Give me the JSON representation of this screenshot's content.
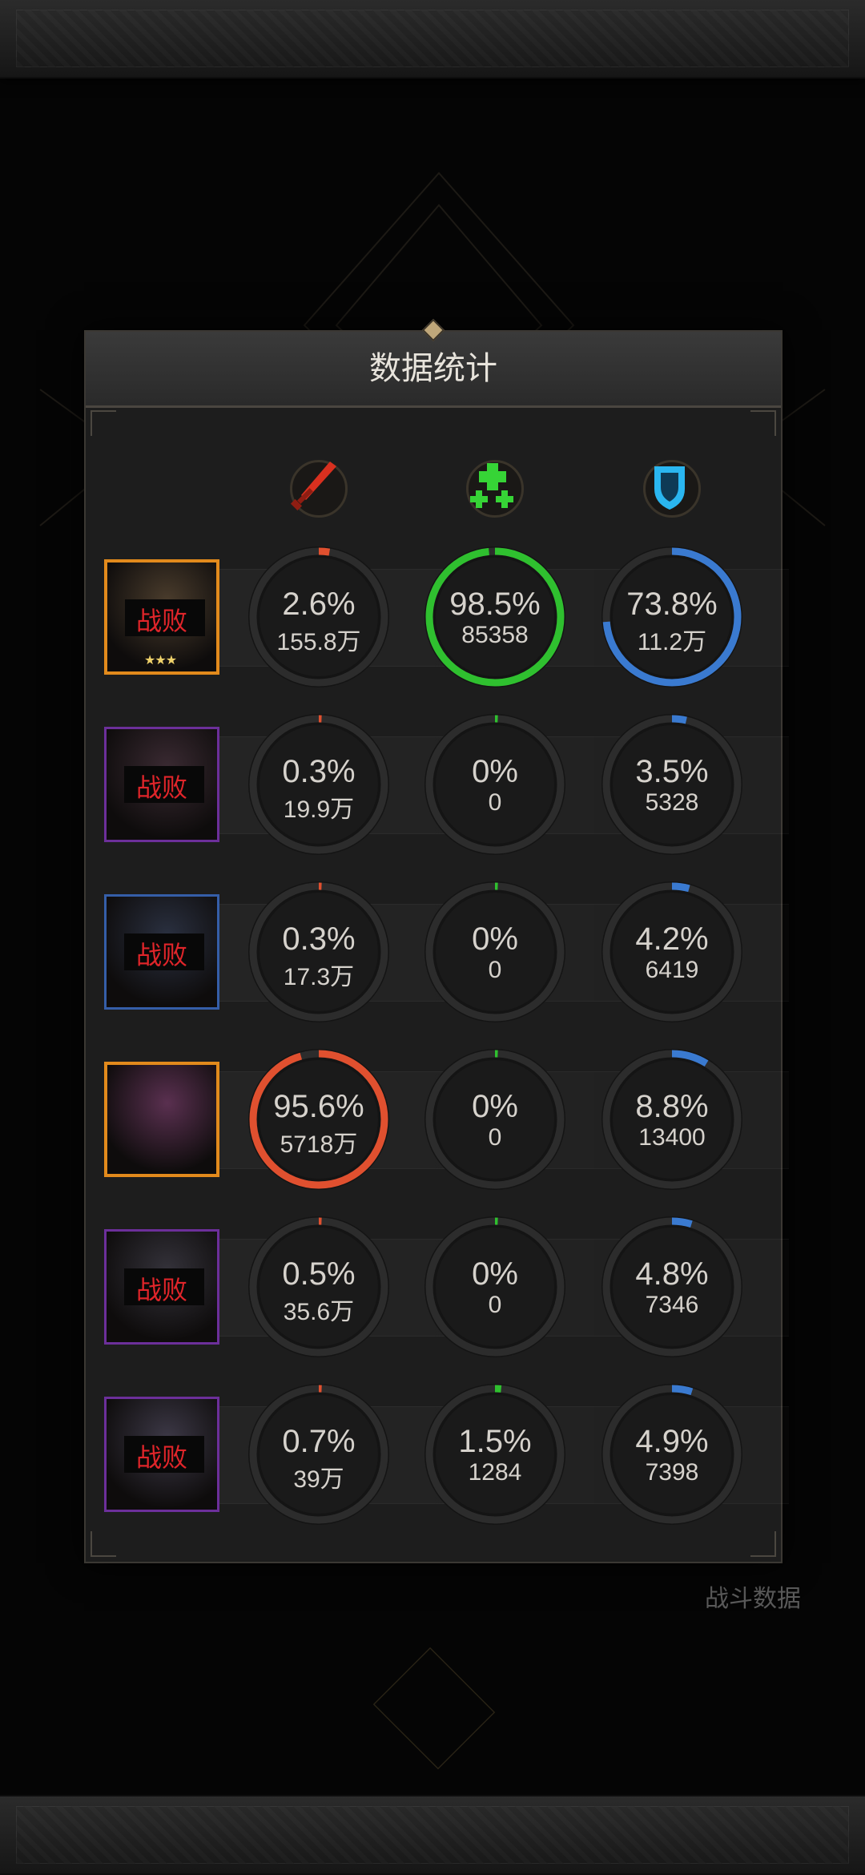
{
  "dialog": {
    "title": "数据统计"
  },
  "background": {
    "battle_data_label": "战斗数据"
  },
  "columns": [
    {
      "icon": "sword-icon",
      "color": "#e0402a"
    },
    {
      "icon": "heal-cross-icon",
      "color": "#2fc72f"
    },
    {
      "icon": "shield-icon",
      "color": "#2fa8e8"
    }
  ],
  "colors": {
    "damage": "#e0502f",
    "heal": "#2fc02f",
    "tank": "#3a7ad0",
    "defeat": "#e0252a"
  },
  "rows": [
    {
      "avatar_border": "orange",
      "defeated": true,
      "defeat_label": "战败",
      "stars": "★★★",
      "damage": {
        "pct": "2.6%",
        "val": "155.8万",
        "frac": 0.026
      },
      "heal": {
        "pct": "98.5%",
        "val": "85358",
        "frac": 0.985
      },
      "tank": {
        "pct": "73.8%",
        "val": "11.2万",
        "frac": 0.738
      }
    },
    {
      "avatar_border": "purple",
      "defeated": true,
      "defeat_label": "战败",
      "stars": "",
      "damage": {
        "pct": "0.3%",
        "val": "19.9万",
        "frac": 0.003
      },
      "heal": {
        "pct": "0%",
        "val": "0",
        "frac": 0
      },
      "tank": {
        "pct": "3.5%",
        "val": "5328",
        "frac": 0.035
      }
    },
    {
      "avatar_border": "blue",
      "defeated": true,
      "defeat_label": "战败",
      "stars": "",
      "damage": {
        "pct": "0.3%",
        "val": "17.3万",
        "frac": 0.003
      },
      "heal": {
        "pct": "0%",
        "val": "0",
        "frac": 0
      },
      "tank": {
        "pct": "4.2%",
        "val": "6419",
        "frac": 0.042
      }
    },
    {
      "avatar_border": "orange",
      "defeated": false,
      "defeat_label": "",
      "stars": "",
      "damage": {
        "pct": "95.6%",
        "val": "5718万",
        "frac": 0.956
      },
      "heal": {
        "pct": "0%",
        "val": "0",
        "frac": 0
      },
      "tank": {
        "pct": "8.8%",
        "val": "13400",
        "frac": 0.088
      }
    },
    {
      "avatar_border": "purple",
      "defeated": true,
      "defeat_label": "战败",
      "stars": "",
      "damage": {
        "pct": "0.5%",
        "val": "35.6万",
        "frac": 0.005
      },
      "heal": {
        "pct": "0%",
        "val": "0",
        "frac": 0
      },
      "tank": {
        "pct": "4.8%",
        "val": "7346",
        "frac": 0.048
      }
    },
    {
      "avatar_border": "purple",
      "defeated": true,
      "defeat_label": "战败",
      "stars": "",
      "damage": {
        "pct": "0.7%",
        "val": "39万",
        "frac": 0.007
      },
      "heal": {
        "pct": "1.5%",
        "val": "1284",
        "frac": 0.015
      },
      "tank": {
        "pct": "4.9%",
        "val": "7398",
        "frac": 0.049
      }
    }
  ]
}
